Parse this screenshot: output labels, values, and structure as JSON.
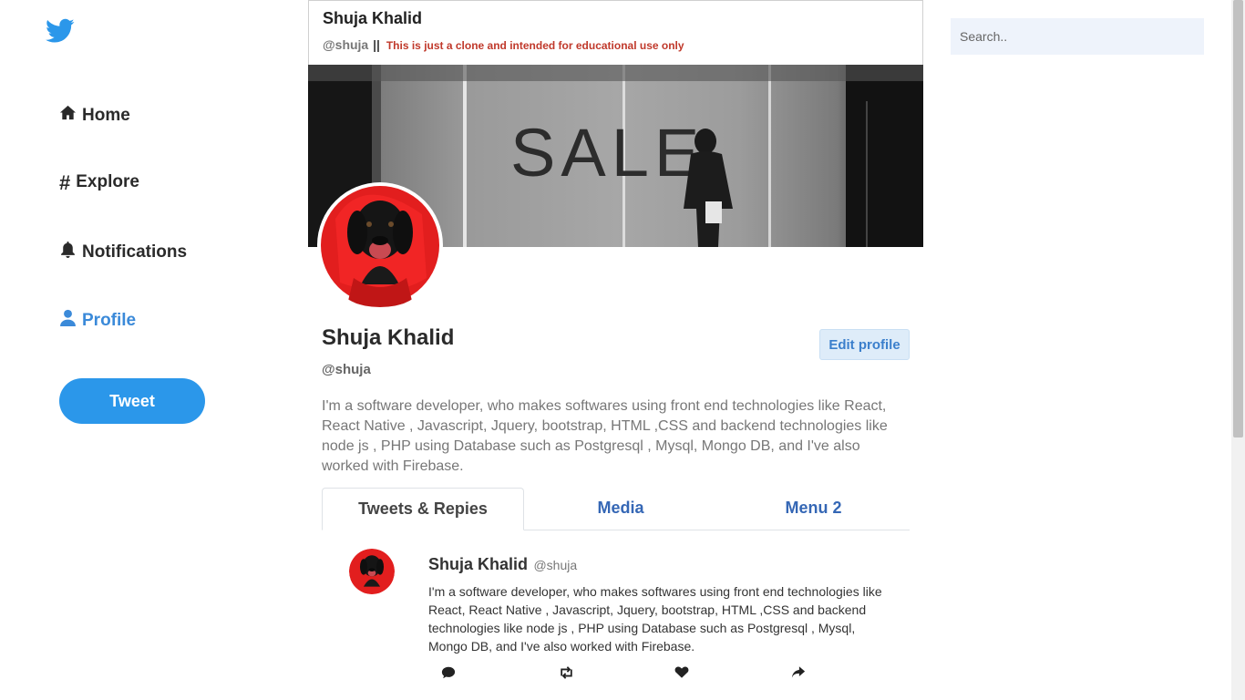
{
  "sidebar": {
    "items": [
      {
        "label": "Home",
        "icon": "home-icon"
      },
      {
        "label": "Explore",
        "icon": "hashtag-icon"
      },
      {
        "label": "Notifications",
        "icon": "bell-icon"
      },
      {
        "label": "Profile",
        "icon": "user-icon",
        "active": true
      }
    ],
    "tweet_label": "Tweet"
  },
  "header": {
    "name": "Shuja Khalid",
    "handle": "@shuja",
    "separator": "||",
    "note": "This is just a clone and intended for educational use only"
  },
  "cover": {
    "sign_text": "SALE"
  },
  "profile": {
    "name": "Shuja Khalid",
    "handle": "@shuja",
    "edit_label": "Edit profile",
    "bio": "I'm a software developer, who makes softwares using front end technologies like React, React Native , Javascript, Jquery, bootstrap, HTML ,CSS and backend technologies like node js , PHP using Database such as Postgresql , Mysql, Mongo DB, and I've also worked with Firebase."
  },
  "tabs": [
    {
      "label": "Tweets & Repies",
      "active": true
    },
    {
      "label": "Media"
    },
    {
      "label": "Menu 2"
    }
  ],
  "post": {
    "name": "Shuja Khalid",
    "handle": "@shuja",
    "text": "I'm a software developer, who makes softwares using front end technologies like React, React Native , Javascript, Jquery, bootstrap, HTML ,CSS and backend technologies like node js , PHP using Database such as Postgresql , Mysql, Mongo DB, and I've also worked with Firebase.",
    "actions": [
      "comment-icon",
      "retweet-icon",
      "heart-icon",
      "share-icon"
    ]
  },
  "search": {
    "placeholder": "Search.."
  },
  "colors": {
    "accent": "#2b97ea",
    "active_nav": "#3b8ad9",
    "tab_link": "#3567b5",
    "note": "#c0392b"
  }
}
